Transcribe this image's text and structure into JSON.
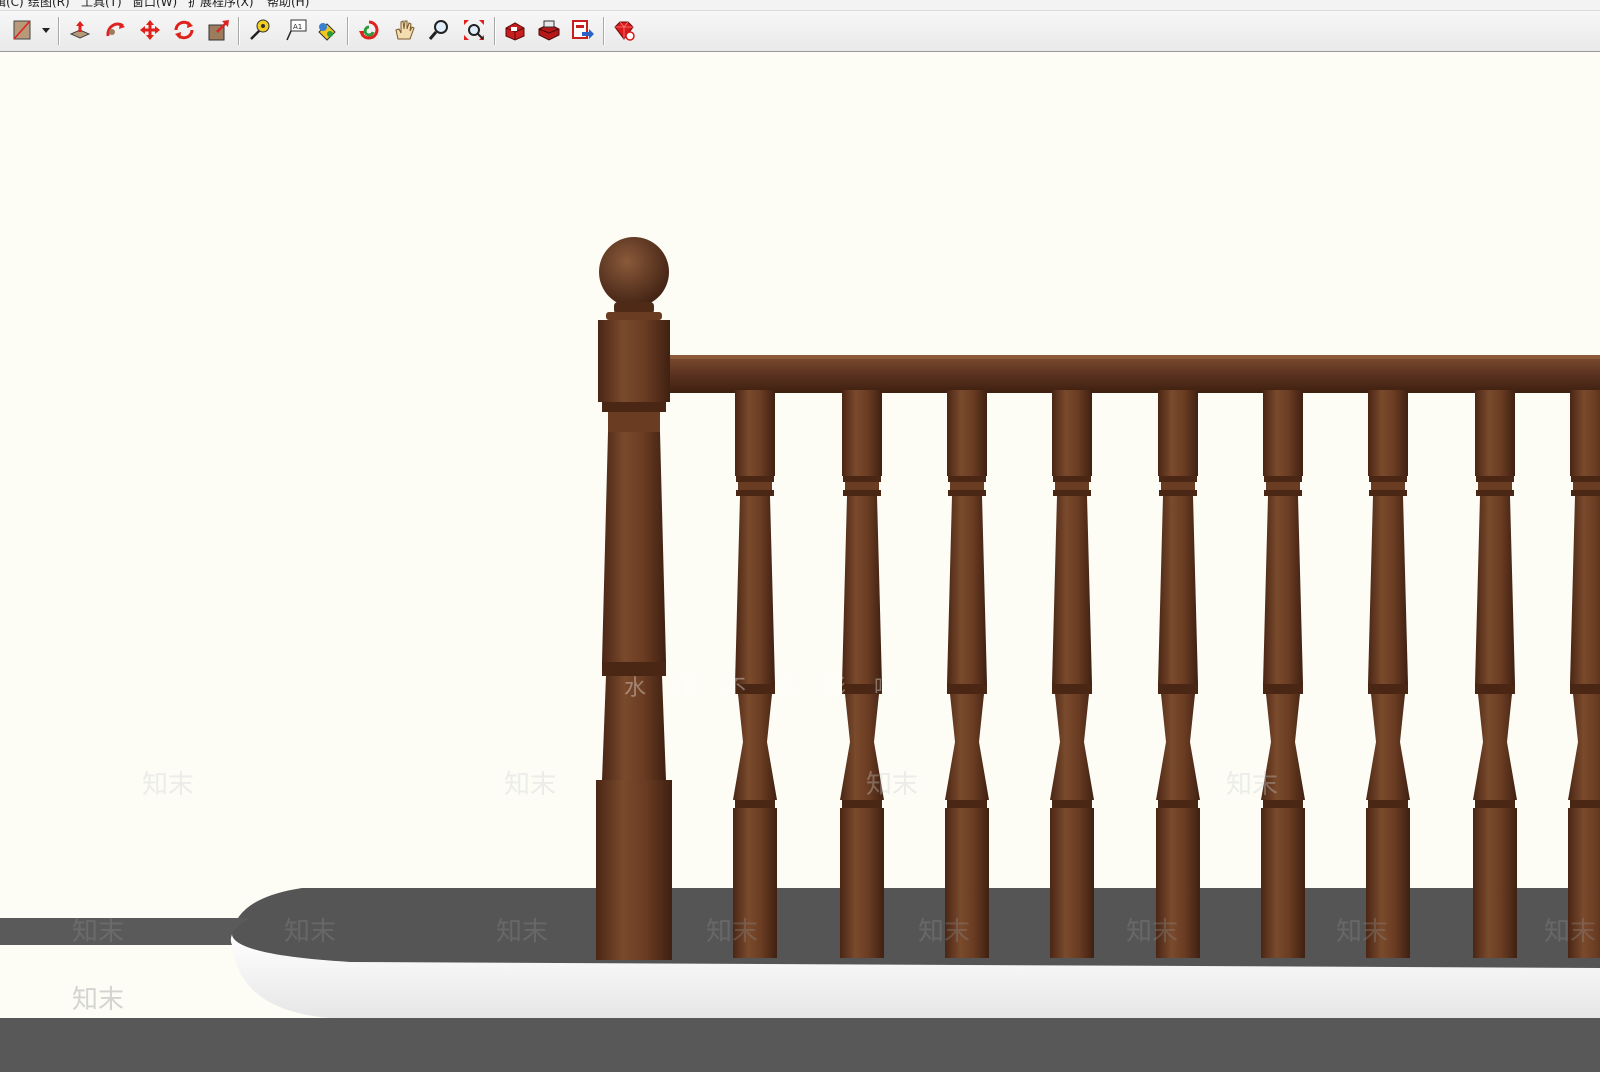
{
  "app": {
    "menus": [
      {
        "label": "编辑(C)"
      },
      {
        "label": "绘图(R)"
      },
      {
        "label": "工具(T)"
      },
      {
        "label": "窗口(W)"
      },
      {
        "label": "扩展程序(X)"
      },
      {
        "label": "帮助(H)"
      }
    ]
  },
  "toolbar": {
    "tools": [
      {
        "icon": "paint-bucket-icon"
      },
      {
        "icon": "dropdown-arrow-icon"
      },
      {
        "icon": "push-pull-icon"
      },
      {
        "icon": "follow-me-icon"
      },
      {
        "icon": "move-icon"
      },
      {
        "icon": "rotate-icon"
      },
      {
        "icon": "scale-icon"
      },
      {
        "icon": "tape-measure-icon"
      },
      {
        "icon": "text-label-icon",
        "text": "A1"
      },
      {
        "icon": "paint-icon"
      },
      {
        "icon": "orbit-icon"
      },
      {
        "icon": "pan-hand-icon"
      },
      {
        "icon": "zoom-icon"
      },
      {
        "icon": "zoom-extents-icon"
      },
      {
        "icon": "warehouse-icon"
      },
      {
        "icon": "share-model-icon"
      },
      {
        "icon": "export-icon"
      },
      {
        "icon": "ruby-extension-icon"
      }
    ]
  },
  "viewport": {
    "watermark_overlay": "水印不会影响",
    "watermark_text": "知末",
    "colors": {
      "sky": "#fdfdf6",
      "wood_dark": "#4f2b18",
      "wood_mid": "#6e4026",
      "wood_light": "#8a5a3a",
      "floor": "#535353",
      "floor_edge": "#f6f6f6"
    }
  }
}
